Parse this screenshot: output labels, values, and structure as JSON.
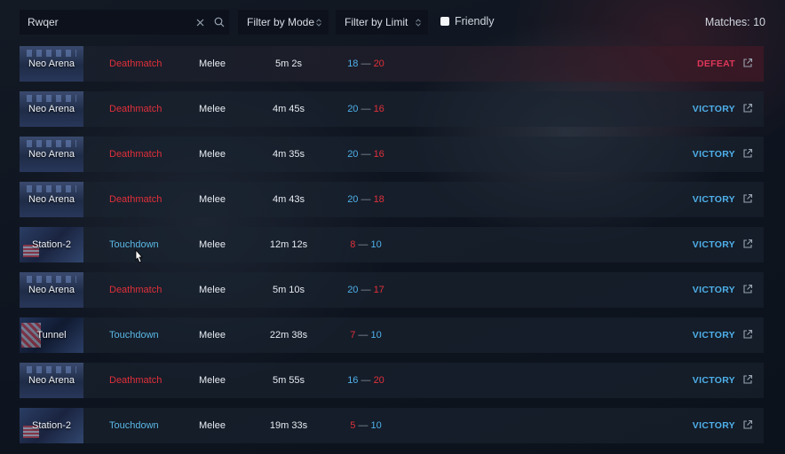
{
  "search": {
    "value": "Rwqer"
  },
  "filters": {
    "mode_label": "Filter by Mode",
    "limit_label": "Filter by Limit",
    "friendly_label": "Friendly"
  },
  "matches_label": "Matches: 10",
  "colors": {
    "victory": "#4fb0ea",
    "defeat": "#e0365a",
    "deathmatch": "#e0303a",
    "touchdown": "#5bb8e6"
  },
  "rows": [
    {
      "map": "Neo Arena",
      "map_type": "arena",
      "mode": "Deathmatch",
      "weapon": "Melee",
      "duration": "5m 2s",
      "score_a": "18",
      "score_b": "20",
      "result": "DEFEAT"
    },
    {
      "map": "Neo Arena",
      "map_type": "arena",
      "mode": "Deathmatch",
      "weapon": "Melee",
      "duration": "4m 45s",
      "score_a": "20",
      "score_b": "16",
      "result": "VICTORY"
    },
    {
      "map": "Neo Arena",
      "map_type": "arena",
      "mode": "Deathmatch",
      "weapon": "Melee",
      "duration": "4m 35s",
      "score_a": "20",
      "score_b": "16",
      "result": "VICTORY"
    },
    {
      "map": "Neo Arena",
      "map_type": "arena",
      "mode": "Deathmatch",
      "weapon": "Melee",
      "duration": "4m 43s",
      "score_a": "20",
      "score_b": "18",
      "result": "VICTORY"
    },
    {
      "map": "Station-2",
      "map_type": "station",
      "mode": "Touchdown",
      "weapon": "Melee",
      "duration": "12m 12s",
      "score_a": "8",
      "score_b": "10",
      "result": "VICTORY"
    },
    {
      "map": "Neo Arena",
      "map_type": "arena",
      "mode": "Deathmatch",
      "weapon": "Melee",
      "duration": "5m 10s",
      "score_a": "20",
      "score_b": "17",
      "result": "VICTORY"
    },
    {
      "map": "Tunnel",
      "map_type": "tunnel",
      "mode": "Touchdown",
      "weapon": "Melee",
      "duration": "22m 38s",
      "score_a": "7",
      "score_b": "10",
      "result": "VICTORY"
    },
    {
      "map": "Neo Arena",
      "map_type": "arena",
      "mode": "Deathmatch",
      "weapon": "Melee",
      "duration": "5m 55s",
      "score_a": "16",
      "score_b": "20",
      "result": "VICTORY"
    },
    {
      "map": "Station-2",
      "map_type": "station",
      "mode": "Touchdown",
      "weapon": "Melee",
      "duration": "19m 33s",
      "score_a": "5",
      "score_b": "10",
      "result": "VICTORY"
    }
  ]
}
